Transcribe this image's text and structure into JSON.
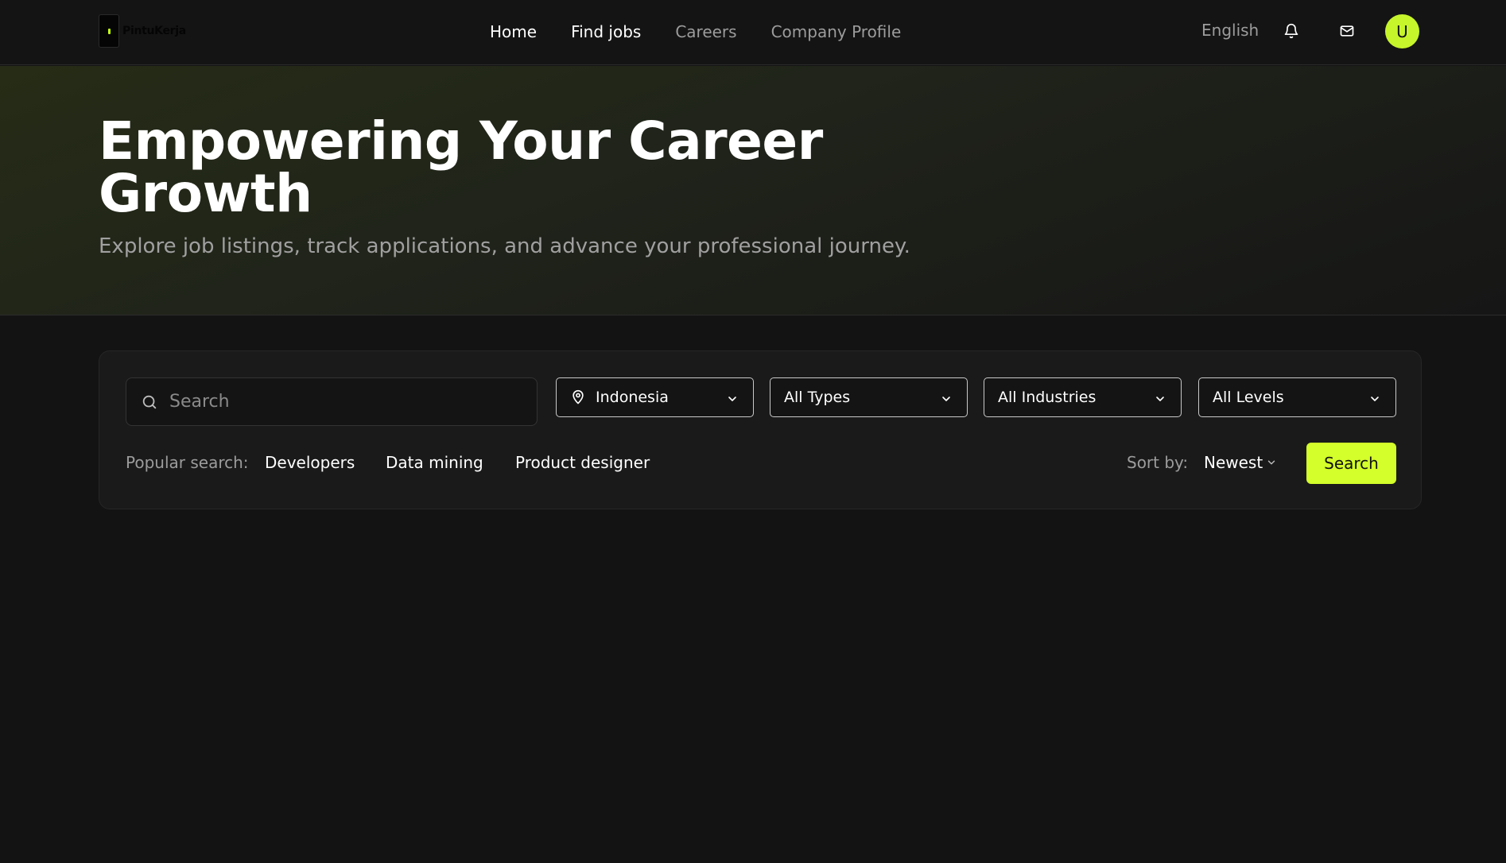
{
  "brand": {
    "name": "PintuKerja"
  },
  "nav": {
    "items": [
      {
        "label": "Home",
        "active": true
      },
      {
        "label": "Find jobs",
        "active": true
      },
      {
        "label": "Careers",
        "active": false
      },
      {
        "label": "Company Profile",
        "active": false
      }
    ]
  },
  "header": {
    "language": "English",
    "icons": [
      "bell-icon",
      "mail-icon"
    ],
    "avatar_initial": "U"
  },
  "hero": {
    "title": "Empowering Your Career Growth",
    "subtitle": "Explore job listings, track applications, and advance your professional journey."
  },
  "search": {
    "placeholder": "Search",
    "value": "",
    "filters": {
      "location": "Indonesia",
      "type": "All Types",
      "industry": "All Industries",
      "level": "All Levels"
    },
    "popular_label": "Popular search:",
    "popular": [
      "Developers",
      "Data mining",
      "Product designer"
    ],
    "sort_label": "Sort by:",
    "sort_value": "Newest",
    "button_label": "Search"
  },
  "colors": {
    "accent": "#d4ff2a",
    "background": "#131313",
    "panel": "#1a1a1a"
  }
}
